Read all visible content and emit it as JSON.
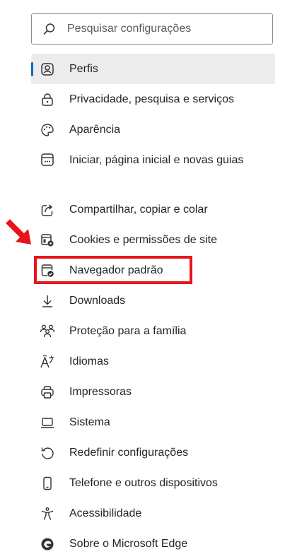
{
  "search": {
    "placeholder": "Pesquisar configurações",
    "icon": "search-icon"
  },
  "nav": {
    "accent_color": "#0f6cbd",
    "items": [
      {
        "label": "Perfis",
        "icon": "profile-icon",
        "selected": true
      },
      {
        "label": "Privacidade, pesquisa e serviços",
        "icon": "lock-icon"
      },
      {
        "label": "Aparência",
        "icon": "palette-icon"
      },
      {
        "label": "Iniciar, página inicial e novas guias",
        "icon": "browser-window-icon"
      },
      {
        "label": "Compartilhar, copiar e colar",
        "icon": "share-icon"
      },
      {
        "label": "Cookies e permissões de site",
        "icon": "site-permissions-icon"
      },
      {
        "label": "Navegador padrão",
        "icon": "default-browser-icon",
        "highlighted": true
      },
      {
        "label": "Downloads",
        "icon": "download-icon"
      },
      {
        "label": "Proteção para a família",
        "icon": "family-icon"
      },
      {
        "label": "Idiomas",
        "icon": "language-icon"
      },
      {
        "label": "Impressoras",
        "icon": "printer-icon"
      },
      {
        "label": "Sistema",
        "icon": "laptop-icon"
      },
      {
        "label": "Redefinir configurações",
        "icon": "reset-icon"
      },
      {
        "label": "Telefone e outros dispositivos",
        "icon": "phone-icon"
      },
      {
        "label": "Acessibilidade",
        "icon": "accessibility-icon"
      },
      {
        "label": "Sobre o Microsoft Edge",
        "icon": "edge-logo-icon"
      }
    ]
  },
  "annotation": {
    "color": "#e8141b"
  }
}
